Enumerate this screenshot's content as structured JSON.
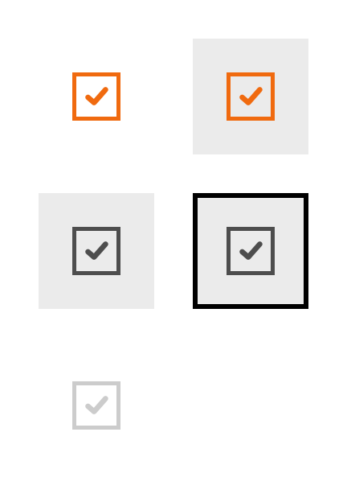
{
  "colors": {
    "accent": "#f06a0f",
    "dark": "#4d4d4d",
    "disabled": "#cccccc",
    "hover_background": "#ebebeb",
    "focus_outline": "#000000"
  },
  "checkboxes": [
    {
      "state": "checked-default",
      "checked": true,
      "color_key": "accent",
      "icon": "checkmark-icon"
    },
    {
      "state": "checked-hover",
      "checked": true,
      "color_key": "accent",
      "icon": "checkmark-icon"
    },
    {
      "state": "checked-pressed",
      "checked": true,
      "color_key": "dark",
      "icon": "checkmark-icon"
    },
    {
      "state": "checked-focused",
      "checked": true,
      "color_key": "dark",
      "icon": "checkmark-icon"
    },
    {
      "state": "checked-disabled",
      "checked": true,
      "color_key": "disabled",
      "icon": "checkmark-icon"
    }
  ]
}
